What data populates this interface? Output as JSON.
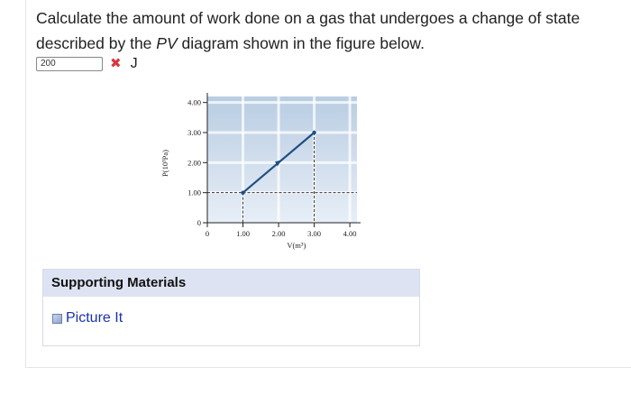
{
  "question": {
    "text_before": "Calculate the amount of work done on a gas that undergoes a change of state described by the ",
    "text_italic": "PV",
    "text_after": " diagram shown in the figure below."
  },
  "answer": {
    "value": "200",
    "status_icon": "x-mark-icon",
    "status_color": "#d9363e",
    "unit": "J"
  },
  "chart_data": {
    "type": "line",
    "xlabel": "V(m³)",
    "ylabel": "P(10³Pa)",
    "x_ticks": [
      "0",
      "1.00",
      "2.00",
      "3.00",
      "4.00"
    ],
    "y_ticks": [
      "0",
      "1.00",
      "2.00",
      "3.00",
      "4.00"
    ],
    "xlim": [
      0,
      4.2
    ],
    "ylim": [
      0,
      4.2
    ],
    "grid": true,
    "series": [
      {
        "x": [
          1.0,
          2.0,
          3.0
        ],
        "y": [
          1.0,
          2.0,
          3.0
        ]
      }
    ],
    "colors": {
      "plot_bg": "#b9cde2",
      "line": "#1f4f82",
      "point": "#1f4f82"
    }
  },
  "support": {
    "header": "Supporting Materials",
    "link_label": "Picture It",
    "link_icon": "book-icon"
  }
}
